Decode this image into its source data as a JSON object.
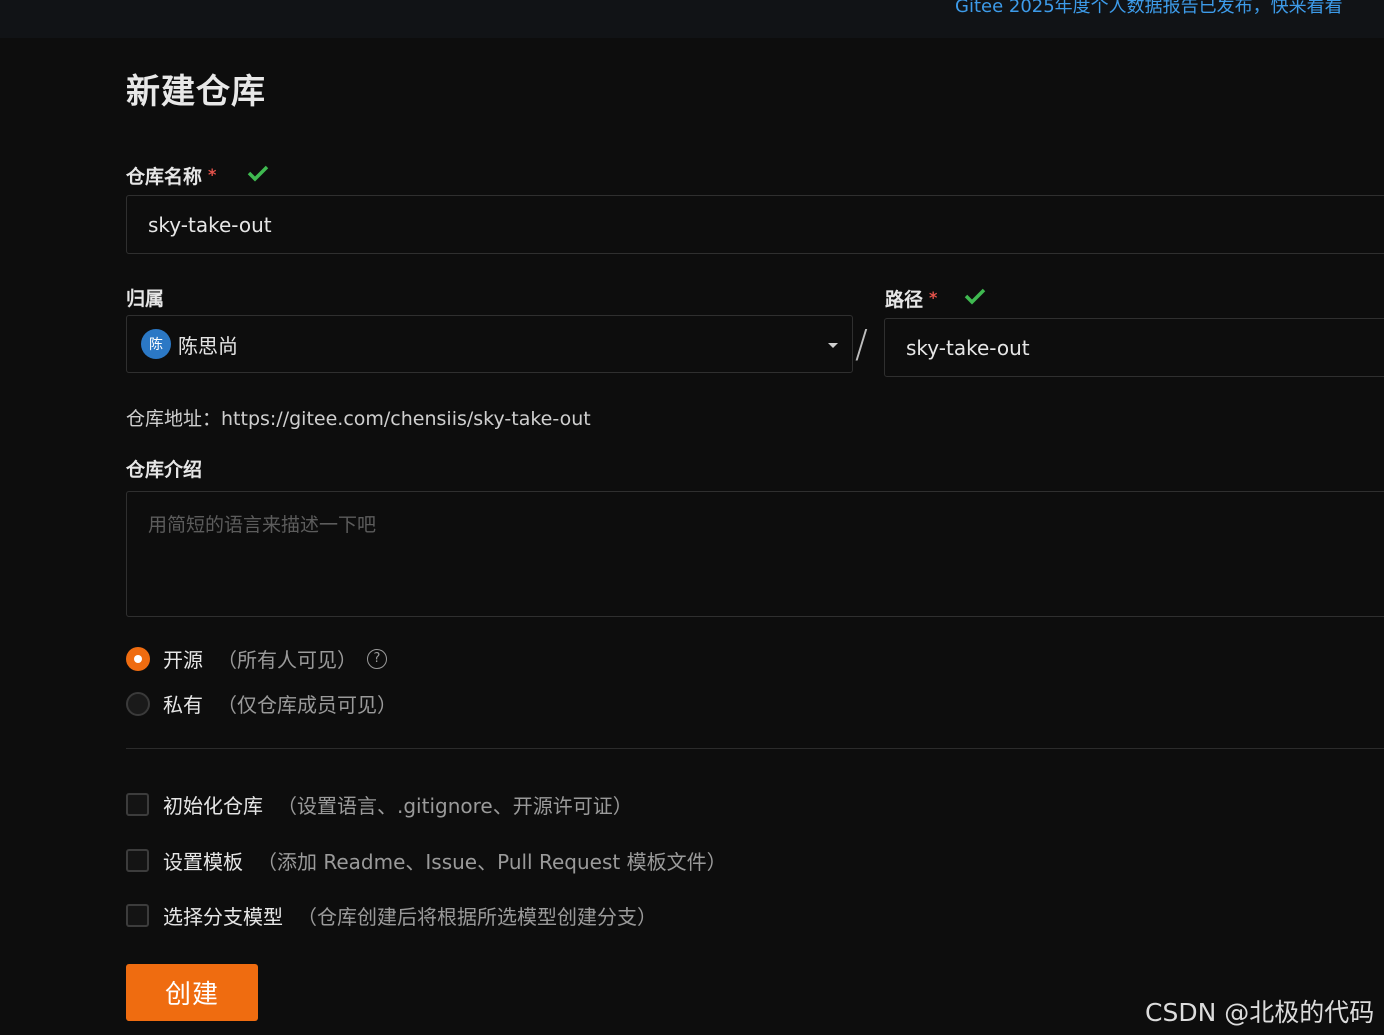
{
  "topbar": {
    "announcement": "Gitee 2025年度个人数据报告已发布，快来看看"
  },
  "page_title": "新建仓库",
  "repo_name": {
    "label": "仓库名称",
    "required_mark": "*",
    "value": "sky-take-out"
  },
  "owner": {
    "label": "归属",
    "avatar_text": "陈",
    "name": "陈思尚"
  },
  "path": {
    "label": "路径",
    "required_mark": "*",
    "separator": "/",
    "value": "sky-take-out"
  },
  "repo_address": {
    "text": "仓库地址：https://gitee.com/chensiis/sky-take-out"
  },
  "description": {
    "label": "仓库介绍",
    "placeholder": "用简短的语言来描述一下吧"
  },
  "visibility": {
    "public_label": "开源",
    "public_hint": "（所有人可见）",
    "private_label": "私有",
    "private_hint": "（仅仓库成员可见）",
    "selected": "public"
  },
  "options": [
    {
      "label": "初始化仓库",
      "hint": "（设置语言、.gitignore、开源许可证）"
    },
    {
      "label": "设置模板",
      "hint": "（添加 Readme、Issue、Pull Request 模板文件）"
    },
    {
      "label": "选择分支模型",
      "hint": "（仓库创建后将根据所选模型创建分支）"
    }
  ],
  "create_button": "创建",
  "watermark": "CSDN @北极的代码",
  "colors": {
    "accent": "#ef6c10",
    "success": "#3fb950",
    "required": "#e5534b",
    "link": "#3d9be9"
  }
}
